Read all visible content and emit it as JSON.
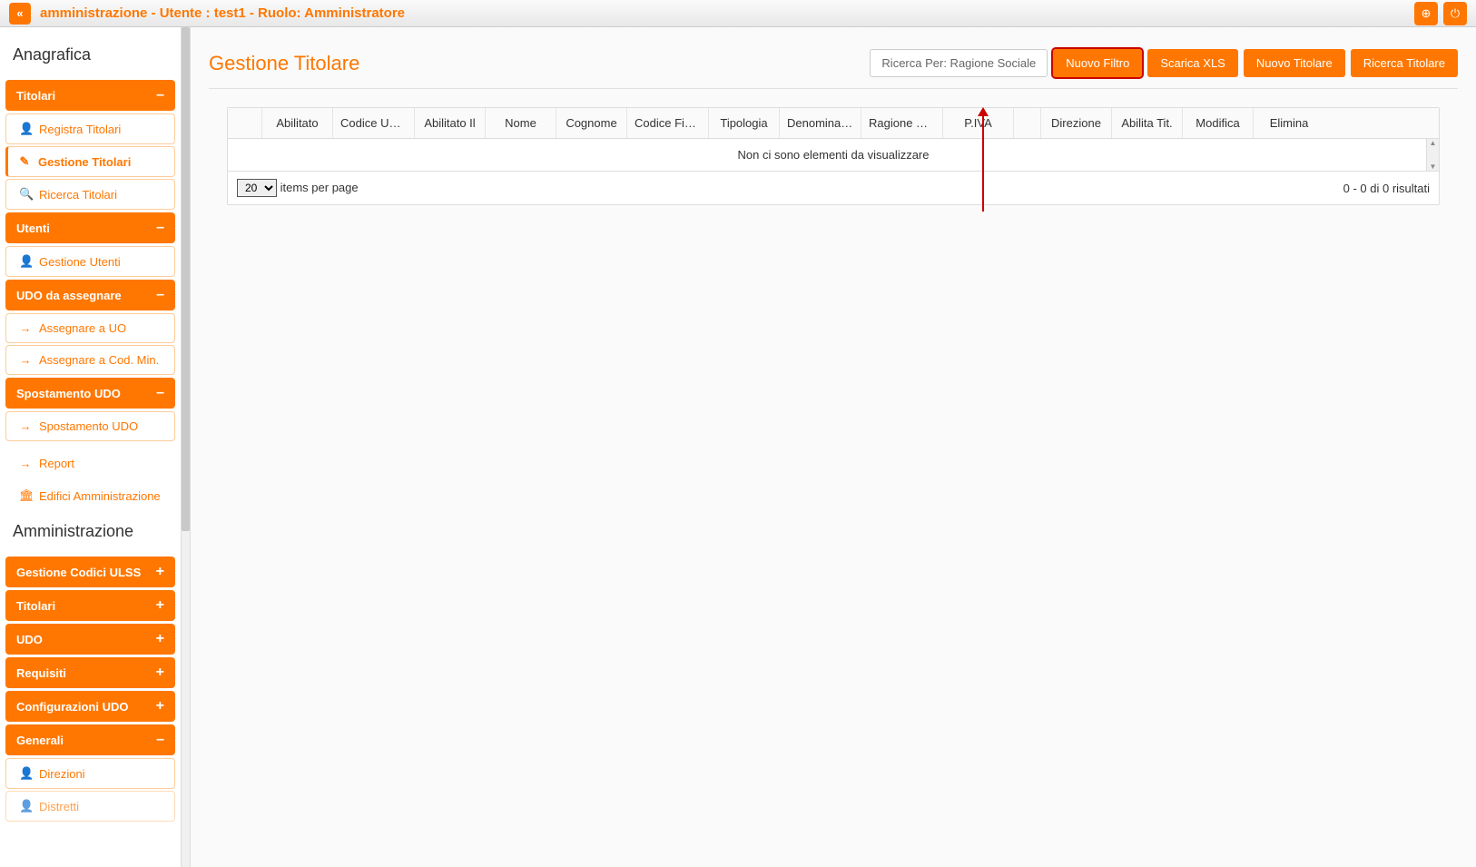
{
  "topbar": {
    "title": "amministrazione - Utente : test1 - Ruolo: Amministratore",
    "collapse_glyph": "«",
    "globe_glyph": "⊕",
    "power_glyph": "⏻"
  },
  "sidebar": {
    "heading1": "Anagrafica",
    "heading2": "Amministrazione",
    "groups": {
      "titolari": {
        "label": "Titolari",
        "toggle": "–"
      },
      "utenti": {
        "label": "Utenti",
        "toggle": "–"
      },
      "udo_assegnare": {
        "label": "UDO da assegnare",
        "toggle": "–"
      },
      "spostamento_udo": {
        "label": "Spostamento UDO",
        "toggle": "–"
      },
      "gestione_codici": {
        "label": "Gestione Codici ULSS",
        "toggle": "+"
      },
      "titolari2": {
        "label": "Titolari",
        "toggle": "+"
      },
      "udo": {
        "label": "UDO",
        "toggle": "+"
      },
      "requisiti": {
        "label": "Requisiti",
        "toggle": "+"
      },
      "config_udo": {
        "label": "Configurazioni UDO",
        "toggle": "+"
      },
      "generali": {
        "label": "Generali",
        "toggle": "–"
      }
    },
    "items": {
      "registra_titolari": "Registra Titolari",
      "gestione_titolari": "Gestione Titolari",
      "ricerca_titolari": "Ricerca Titolari",
      "gestione_utenti": "Gestione Utenti",
      "assegnare_uo": "Assegnare a UO",
      "assegnare_cod": "Assegnare a Cod. Min.",
      "spostamento_udo_item": "Spostamento UDO",
      "report": "Report",
      "edifici": "Edifici Amministrazione",
      "direzioni": "Direzioni",
      "distretti": "Distretti"
    }
  },
  "page": {
    "title": "Gestione Titolare",
    "search_label": "Ricerca Per:  Ragione Sociale",
    "buttons": {
      "nuovo_filtro": "Nuovo Filtro",
      "scarica_xls": "Scarica XLS",
      "nuovo_titolare": "Nuovo Titolare",
      "ricerca_titolare": "Ricerca Titolare"
    }
  },
  "grid": {
    "columns": [
      "",
      "Abilitato",
      "Codice Univ...",
      "Abilitato Il",
      "Nome",
      "Cognome",
      "Codice Fisc...",
      "Tipologia",
      "Denominazi...",
      "Ragione So...",
      "P.IVA",
      "",
      "Direzione",
      "Abilita Tit.",
      "Modifica",
      "Elimina"
    ],
    "empty_message": "Non ci sono elementi da visualizzare",
    "page_size_value": "20",
    "page_size_label": "items per page",
    "result_summary": "0 - 0 di 0 risultati"
  }
}
